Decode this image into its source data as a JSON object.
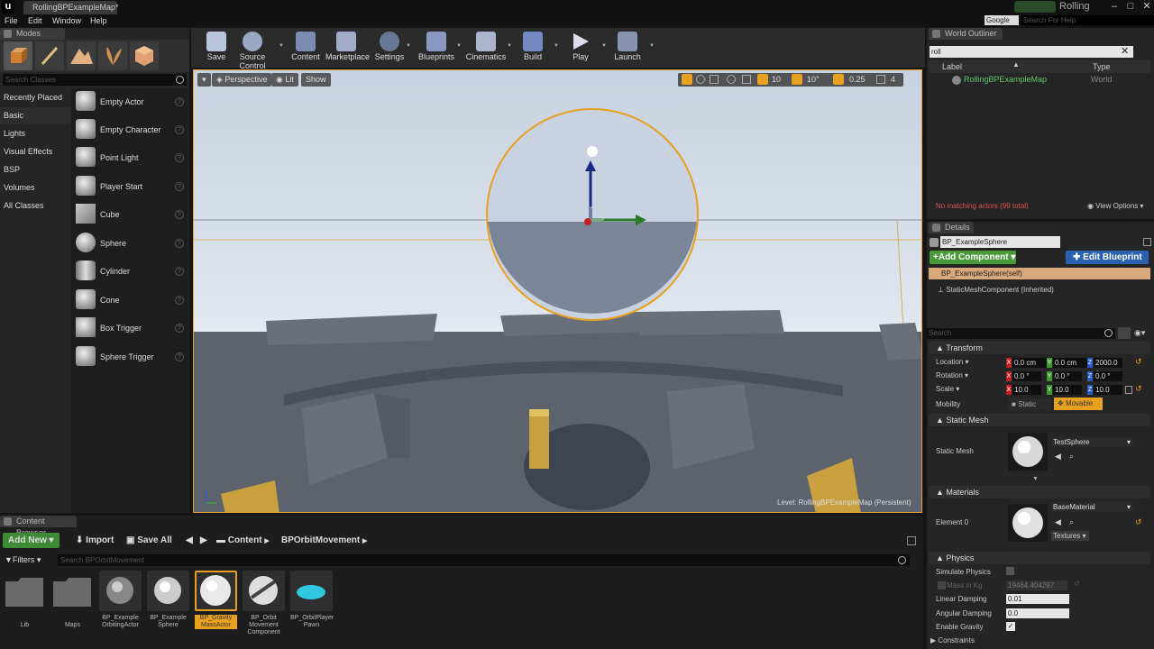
{
  "window": {
    "tab_title": "RollingBPExampleMap*",
    "project_name": "Rolling",
    "search_help_placeholder": "Search For Help",
    "search_provider": "Google"
  },
  "menu": [
    "File",
    "Edit",
    "Window",
    "Help"
  ],
  "modes": {
    "tab_label": "Modes",
    "search_placeholder": "Search Classes",
    "categories": [
      "Recently Placed",
      "Basic",
      "Lights",
      "Visual Effects",
      "BSP",
      "Volumes",
      "All Classes"
    ],
    "selected_category": "Basic",
    "items": [
      "Empty Actor",
      "Empty Character",
      "Point Light",
      "Player Start",
      "Cube",
      "Sphere",
      "Cylinder",
      "Cone",
      "Box Trigger",
      "Sphere Trigger"
    ]
  },
  "toolbar": {
    "buttons": [
      "Save",
      "Source Control",
      "Content",
      "Marketplace",
      "Settings",
      "Blueprints",
      "Cinematics",
      "Build",
      "Play",
      "Launch"
    ]
  },
  "viewport": {
    "perspective_label": "Perspective",
    "lit_label": "Lit",
    "show_label": "Show",
    "grid_snap": "10",
    "rotation_snap": "10°",
    "scale_snap": "0.25",
    "camera_speed": "4",
    "level_prefix": "Level:",
    "level_name": "RollingBPExampleMap (Persistent)"
  },
  "content_browser": {
    "tab_label": "Content Browser",
    "add_new": "Add New",
    "import": "Import",
    "save_all": "Save All",
    "path": [
      "Content",
      "BPOrbitMovement"
    ],
    "filters": "Filters",
    "search_placeholder": "Search BPOrbitMovement",
    "assets": [
      {
        "name": "Lib",
        "kind": "folder"
      },
      {
        "name": "Maps",
        "kind": "folder"
      },
      {
        "name": "BP_Example OrbitingActor",
        "kind": "bp"
      },
      {
        "name": "BP_Example Sphere",
        "kind": "bp"
      },
      {
        "name": "BP_Gravity MassActor",
        "kind": "bp",
        "selected": true
      },
      {
        "name": "BP_Orbit Movement Component",
        "kind": "comp"
      },
      {
        "name": "BP_OrbitPlayer Pawn",
        "kind": "pawn"
      }
    ]
  },
  "outliner": {
    "tab_label": "World Outliner",
    "search_value": "roll",
    "col_label": "Label",
    "col_type": "Type",
    "row_label": "RollingBPExampleMap",
    "row_type": "World",
    "status": "No matching actors (99 total)",
    "view_options": "View Options"
  },
  "details": {
    "tab_label": "Details",
    "actor_name": "BP_ExampleSphere",
    "add_component": "Add Component",
    "edit_blueprint": "Edit Blueprint",
    "self_component": "BP_ExampleSphere(self)",
    "inherited_component": "StaticMeshComponent (Inherited)",
    "search_placeholder": "Search",
    "transform_label": "Transform",
    "location_label": "Location",
    "location": [
      "0.0 cm",
      "0.0 cm",
      "2000.0 c"
    ],
    "rotation_label": "Rotation",
    "rotation": [
      "0.0 °",
      "0.0 °",
      "0.0 °"
    ],
    "scale_label": "Scale",
    "scale": [
      "10.0",
      "10.0",
      "10.0"
    ],
    "mobility_label": "Mobility",
    "mobility_static": "Static",
    "mobility_movable": "Movable",
    "static_mesh_section": "Static Mesh",
    "static_mesh_label": "Static Mesh",
    "static_mesh_value": "TestSphere",
    "materials_section": "Materials",
    "element_label": "Element 0",
    "material_value": "BaseMaterial",
    "textures_label": "Textures",
    "physics_section": "Physics",
    "simulate_physics": "Simulate Physics",
    "mass_label": "Mass in Kg",
    "mass_value": "19464.404297",
    "linear_damping_label": "Linear Damping",
    "linear_damping": "0.01",
    "angular_damping_label": "Angular Damping",
    "angular_damping": "0.0",
    "enable_gravity": "Enable Gravity",
    "constraints": "Constraints"
  },
  "colors": {
    "accent_orange": "#e8a020",
    "add_green": "#4a9a3a",
    "blueprint_blue": "#2a62b0"
  }
}
